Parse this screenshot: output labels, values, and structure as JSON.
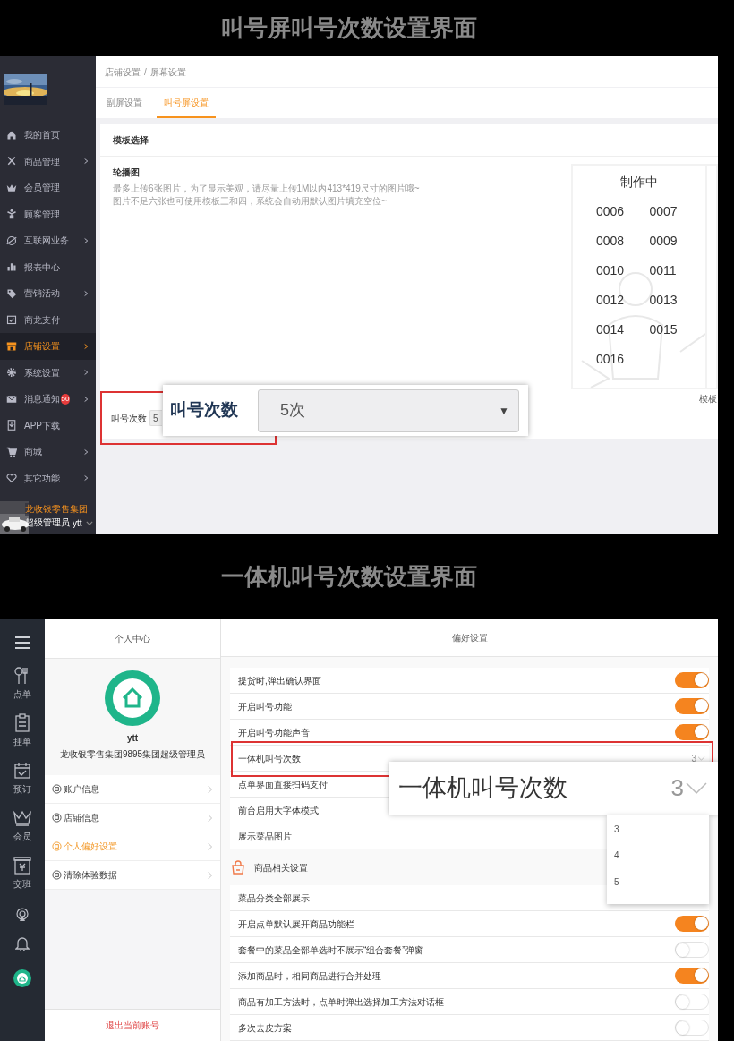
{
  "heading_1": "叫号屏叫号次数设置界面",
  "screen_1": {
    "sidebar": {
      "items": [
        {
          "label": "我的首页",
          "arrow": false,
          "selected": false
        },
        {
          "label": "商品管理",
          "arrow": true,
          "selected": false
        },
        {
          "label": "会员管理",
          "arrow": false,
          "selected": false
        },
        {
          "label": "顾客管理",
          "arrow": false,
          "selected": false
        },
        {
          "label": "互联网业务",
          "arrow": true,
          "selected": false
        },
        {
          "label": "报表中心",
          "arrow": false,
          "selected": false
        },
        {
          "label": "营销活动",
          "arrow": true,
          "selected": false
        },
        {
          "label": "商龙支付",
          "arrow": false,
          "selected": false
        },
        {
          "label": "店铺设置",
          "arrow": true,
          "selected": true
        },
        {
          "label": "系统设置",
          "arrow": true,
          "selected": false
        },
        {
          "label": "消息通知",
          "badge": "50",
          "arrow": true,
          "selected": false
        },
        {
          "label": "APP下载",
          "arrow": false,
          "selected": false
        },
        {
          "label": "商城",
          "arrow": true,
          "selected": false
        },
        {
          "label": "其它功能",
          "arrow": true,
          "selected": false
        }
      ],
      "footer": {
        "org": "龙收银零售集团",
        "role": "超级管理员",
        "user": "ytt"
      }
    },
    "breadcrumb": {
      "items": [
        "店铺设置",
        "屏幕设置"
      ],
      "separator": "/"
    },
    "tabs": [
      {
        "label": "副屏设置",
        "selected": false
      },
      {
        "label": "叫号屏设置",
        "selected": true
      }
    ],
    "section_title": "模板选择",
    "carousel": {
      "title": "轮播图",
      "notes": [
        "最多上传6张图片，为了显示美观，请尽量上传1M以内413*419尺寸的图片哦~",
        "图片不足六张也可使用模板三和四，系统会自动用默认图片填充空位~"
      ]
    },
    "preview": {
      "title": "制作中",
      "numbers": [
        "0006",
        "0007",
        "0008",
        "0009",
        "0010",
        "0011",
        "0012",
        "0013",
        "0014",
        "0015",
        "0016"
      ]
    },
    "template_label": "模板",
    "call_count": {
      "label": "叫号次数",
      "value": "5"
    },
    "callout": {
      "label": "叫号次数",
      "value": "5次",
      "caret": "▼"
    }
  },
  "heading_2": "一体机叫号次数设置界面",
  "screen_2": {
    "rail": {
      "items": [
        {
          "label": "点单"
        },
        {
          "label": "挂单"
        },
        {
          "label": "预订"
        },
        {
          "label": "会员"
        },
        {
          "label": "交班"
        }
      ]
    },
    "profile": {
      "header": "个人中心",
      "name": "ytt",
      "org": "龙收银零售集团9895集团超级管理员",
      "menu": [
        {
          "label": "账户信息",
          "selected": false
        },
        {
          "label": "店铺信息",
          "selected": false
        },
        {
          "label": "个人偏好设置",
          "selected": true
        },
        {
          "label": "清除体验数据",
          "selected": false
        }
      ],
      "logout": "退出当前账号"
    },
    "prefs": {
      "header": "偏好设置",
      "rows": [
        {
          "kind": "toggle",
          "label": "提货时,弹出确认界面",
          "on": true
        },
        {
          "kind": "toggle",
          "label": "开启叫号功能",
          "on": true
        },
        {
          "kind": "toggle",
          "label": "开启叫号功能声音",
          "on": true
        },
        {
          "kind": "select",
          "label": "一体机叫号次数",
          "value": "3"
        },
        {
          "kind": "plain",
          "label": "点单界面直接扫码支付"
        },
        {
          "kind": "plain",
          "label": "前台启用大字体模式"
        },
        {
          "kind": "plain",
          "label": "展示菜品图片"
        },
        {
          "kind": "section",
          "label": "商品相关设置"
        },
        {
          "kind": "plain",
          "label": "菜品分类全部展示"
        },
        {
          "kind": "toggle",
          "label": "开启点单默认展开商品功能栏",
          "on": true
        },
        {
          "kind": "toggle",
          "label": "套餐中的菜品全部单选时不展示“组合套餐”弹窗",
          "on": false
        },
        {
          "kind": "toggle",
          "label": "添加商品时，相同商品进行合并处理",
          "on": true
        },
        {
          "kind": "toggle",
          "label": "商品有加工方法时，点单时弹出选择加工方法对话框",
          "on": false
        },
        {
          "kind": "toggle",
          "label": "多次去皮方案",
          "on": false
        }
      ]
    },
    "callout": {
      "label": "一体机叫号次数",
      "value": "3"
    },
    "dropdown": {
      "options": [
        "3",
        "4",
        "5"
      ]
    }
  }
}
